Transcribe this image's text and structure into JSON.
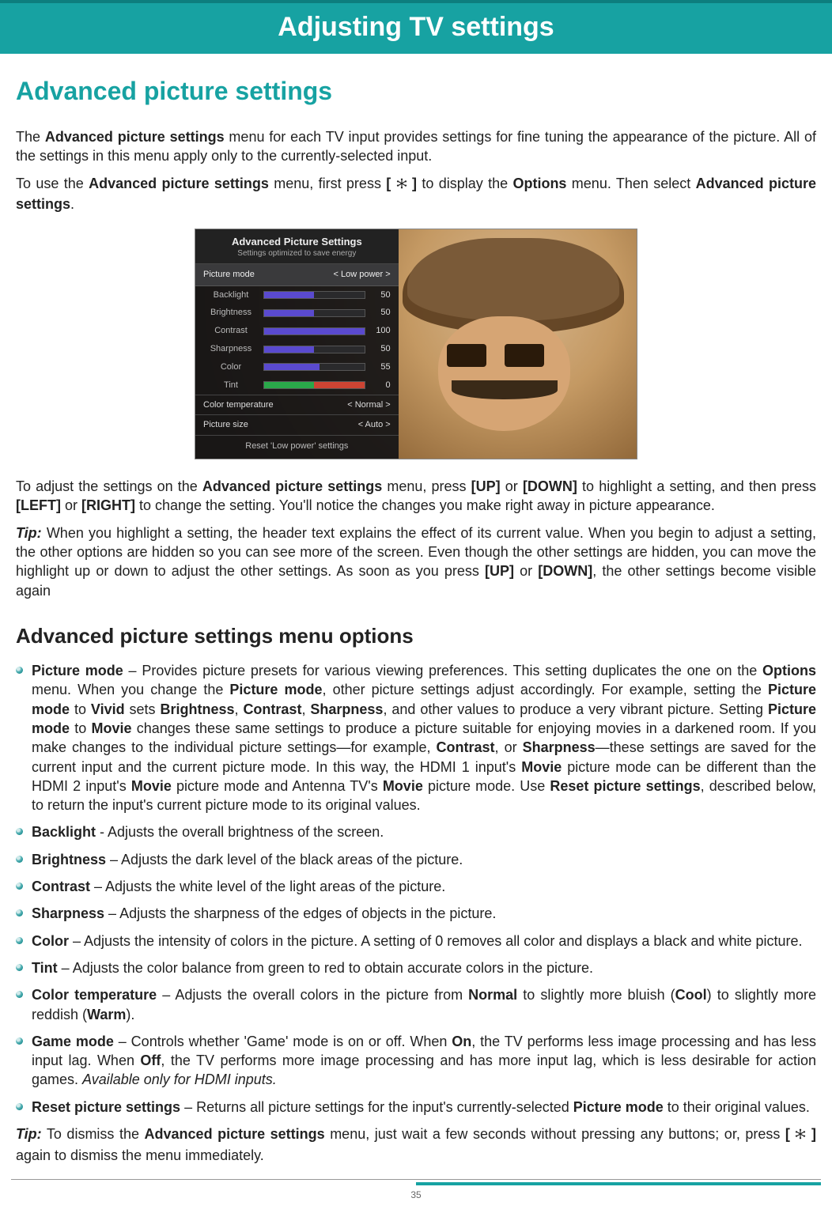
{
  "header": {
    "title": "Adjusting TV settings"
  },
  "h1": "Advanced picture settings",
  "para1": {
    "a": "The ",
    "b": "Advanced picture settings",
    "c": " menu for each TV input provides settings for fine tuning the appearance of the picture. All of the settings in this menu apply only to the currently-selected input."
  },
  "para2": {
    "a": "To use the ",
    "b": "Advanced picture settings",
    "c": " menu, first press ",
    "d": "[ ",
    "e": " ]",
    "f": " to display the ",
    "g": "Options",
    "h": " menu. Then select ",
    "i": "Advanced picture settings",
    "j": "."
  },
  "screenshot": {
    "panel_title": "Advanced Picture Settings",
    "panel_sub": "Settings optimized to save energy",
    "mode_label": "Picture mode",
    "mode_value": "<  Low power  >",
    "rows": [
      {
        "label": "Backlight",
        "value": "50",
        "fill": 50,
        "cls": ""
      },
      {
        "label": "Brightness",
        "value": "50",
        "fill": 50,
        "cls": ""
      },
      {
        "label": "Contrast",
        "value": "100",
        "fill": 100,
        "cls": ""
      },
      {
        "label": "Sharpness",
        "value": "50",
        "fill": 50,
        "cls": ""
      },
      {
        "label": "Color",
        "value": "55",
        "fill": 55,
        "cls": ""
      },
      {
        "label": "Tint",
        "value": "0",
        "fill": 50,
        "cls": "greenred"
      }
    ],
    "sel1_label": "Color temperature",
    "sel1_value": "<   Normal   >",
    "sel2_label": "Picture size",
    "sel2_value": "<    Auto    >",
    "reset": "Reset 'Low power' settings"
  },
  "para3": {
    "a": "To adjust the settings on the ",
    "b": "Advanced picture settings",
    "c": " menu, press ",
    "d": "[UP]",
    "e": " or ",
    "f": "[DOWN]",
    "g": " to highlight a setting, and then press ",
    "h": "[LEFT]",
    "i": " or ",
    "j": "[RIGHT]",
    "k": " to change the setting. You'll notice the changes you make right away in picture appearance."
  },
  "tip1": {
    "label": "Tip:",
    "a": " When you highlight a setting, the header text explains the effect of its current value. When you begin to adjust a setting, the other options are hidden so you can see more of the screen. Even though the other settings are hidden, you can move the highlight up or down to adjust the other settings. As soon as you press ",
    "b": "[UP]",
    "c": " or ",
    "d": "[DOWN]",
    "e": ", the other settings become visible again"
  },
  "h2": "Advanced picture settings menu options",
  "items": [
    {
      "name": "Picture mode",
      "runs": [
        {
          "b": true,
          "t": "Picture mode"
        },
        {
          "t": " – Provides picture presets for various viewing preferences. This setting duplicates the one on the "
        },
        {
          "b": true,
          "t": "Options"
        },
        {
          "t": " menu. When you change the "
        },
        {
          "b": true,
          "t": "Picture mode"
        },
        {
          "t": ", other picture settings adjust accordingly. For example, setting the "
        },
        {
          "b": true,
          "t": "Picture mode"
        },
        {
          "t": " to "
        },
        {
          "b": true,
          "t": "Vivid"
        },
        {
          "t": " sets "
        },
        {
          "b": true,
          "t": "Brightness"
        },
        {
          "t": ", "
        },
        {
          "b": true,
          "t": "Contrast"
        },
        {
          "t": ", "
        },
        {
          "b": true,
          "t": "Sharpness"
        },
        {
          "t": ", and other values to produce a very vibrant picture. Setting "
        },
        {
          "b": true,
          "t": "Picture mode"
        },
        {
          "t": " to "
        },
        {
          "b": true,
          "t": "Movie"
        },
        {
          "t": " changes these same settings to produce a picture suitable for enjoying movies in a darkened room. If you make changes to the individual picture settings—for example, "
        },
        {
          "b": true,
          "t": "Contrast"
        },
        {
          "t": ", or "
        },
        {
          "b": true,
          "t": "Sharpness"
        },
        {
          "t": "—these settings are saved for the current input and the current picture mode. In this way, the HDMI 1 input's "
        },
        {
          "b": true,
          "t": "Movie"
        },
        {
          "t": " picture mode can be different than the HDMI 2 input's "
        },
        {
          "b": true,
          "t": "Movie"
        },
        {
          "t": " picture mode and Antenna TV's "
        },
        {
          "b": true,
          "t": "Movie"
        },
        {
          "t": " picture mode. Use "
        },
        {
          "b": true,
          "t": "Reset picture settings"
        },
        {
          "t": ", described below, to return the input's current picture mode to its original values."
        }
      ]
    },
    {
      "name": "Backlight",
      "runs": [
        {
          "b": true,
          "t": "Backlight"
        },
        {
          "t": " - Adjusts the overall brightness of the screen."
        }
      ]
    },
    {
      "name": "Brightness",
      "runs": [
        {
          "b": true,
          "t": "Brightness"
        },
        {
          "t": " – Adjusts the dark level of the black areas of the picture."
        }
      ]
    },
    {
      "name": "Contrast",
      "runs": [
        {
          "b": true,
          "t": "Contrast"
        },
        {
          "t": " – Adjusts the white level of the light areas of the picture."
        }
      ]
    },
    {
      "name": "Sharpness",
      "runs": [
        {
          "b": true,
          "t": "Sharpness"
        },
        {
          "t": " – Adjusts the sharpness of the edges of objects in the picture."
        }
      ]
    },
    {
      "name": "Color",
      "runs": [
        {
          "b": true,
          "t": "Color"
        },
        {
          "t": " – Adjusts the intensity of colors in the picture. A setting of 0 removes all color and displays a black and white picture."
        }
      ]
    },
    {
      "name": "Tint",
      "runs": [
        {
          "b": true,
          "t": "Tint"
        },
        {
          "t": " – Adjusts the color balance from green to red to obtain accurate colors in the picture."
        }
      ]
    },
    {
      "name": "Color temperature",
      "runs": [
        {
          "b": true,
          "t": "Color temperature"
        },
        {
          "t": " – Adjusts the overall colors in the picture from "
        },
        {
          "b": true,
          "t": "Normal"
        },
        {
          "t": " to slightly more bluish ("
        },
        {
          "b": true,
          "t": "Cool"
        },
        {
          "t": ") to slightly more reddish ("
        },
        {
          "b": true,
          "t": "Warm"
        },
        {
          "t": ")."
        }
      ]
    },
    {
      "name": "Game mode",
      "runs": [
        {
          "b": true,
          "t": "Game mode"
        },
        {
          "t": " – Controls whether 'Game' mode is on or off. When "
        },
        {
          "b": true,
          "t": "On"
        },
        {
          "t": ", the TV performs less image processing and has less input lag. When "
        },
        {
          "b": true,
          "t": "Off"
        },
        {
          "t": ", the TV performs more image processing and has more input lag, which is less desirable for action games. "
        },
        {
          "i": true,
          "t": "Available only for HDMI inputs."
        }
      ]
    },
    {
      "name": "Reset picture settings",
      "runs": [
        {
          "b": true,
          "t": "Reset picture settings"
        },
        {
          "t": " – Returns all picture settings for the input's currently-selected "
        },
        {
          "b": true,
          "t": "Picture mode"
        },
        {
          "t": " to their original values."
        }
      ]
    }
  ],
  "tip2": {
    "label": "Tip:",
    "a": " To dismiss the ",
    "b": "Advanced picture settings",
    "c": " menu, just wait a few seconds without pressing any buttons; or, press ",
    "d": "[ ",
    "e": " ]",
    "f": " again to dismiss the menu immediately."
  },
  "page_num": "35"
}
